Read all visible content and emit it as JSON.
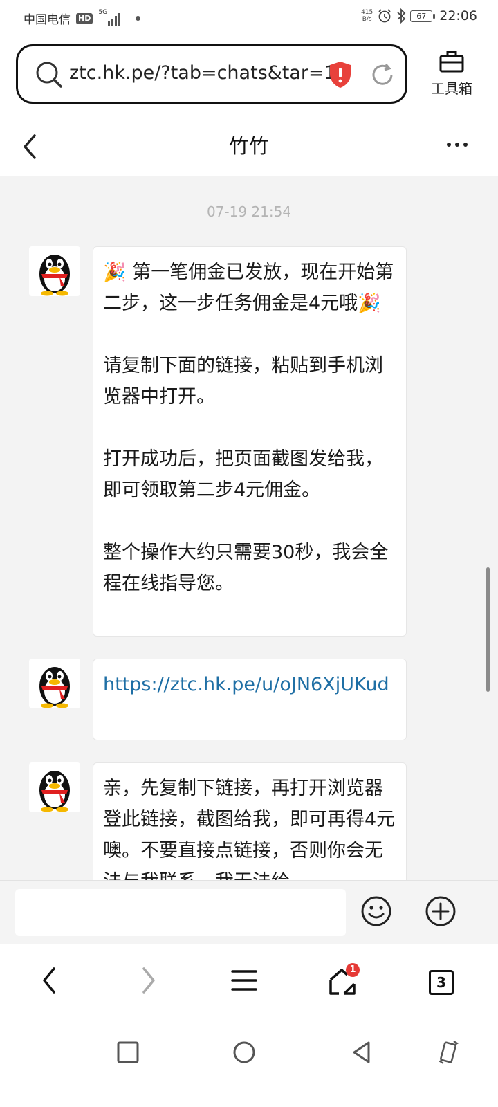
{
  "status_bar": {
    "carrier": "中国电信",
    "hd": "HD",
    "network": "5G",
    "speed_value": "415",
    "speed_unit": "B/s",
    "battery": "67",
    "time": "22:06"
  },
  "browser": {
    "url": "ztc.hk.pe/?tab=chats&tar=1",
    "toolbox_label": "工具箱",
    "tab_count": "3",
    "home_badge": "1"
  },
  "chat": {
    "title": "竹竹",
    "timestamp": "07-19 21:54",
    "messages": [
      {
        "sender": "qq-penguin-avatar",
        "text": "🎉 第一笔佣金已发放，现在开始第二步，这一步任务佣金是4元哦🎉\n\n请复制下面的链接，粘贴到手机浏览器中打开。\n\n打开成功后，把页面截图发给我，即可领取第二步4元佣金。\n\n整个操作大约只需要30秒，我会全程在线指导您。"
      },
      {
        "sender": "qq-penguin-avatar",
        "text": "https://ztc.hk.pe/u/oJN6XjUKud",
        "is_link": true
      },
      {
        "sender": "qq-penguin-avatar",
        "text": "亲，先复制下链接，再打开浏览器登此链接，截图给我，即可再得4元噢。不要直接点链接，否则你会无法与我联系，我无法给"
      }
    ]
  },
  "input": {
    "placeholder": ""
  }
}
